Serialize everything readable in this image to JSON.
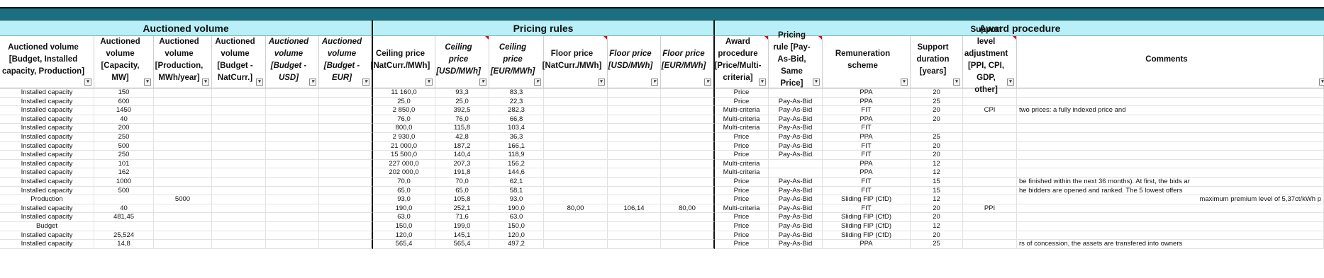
{
  "groups": {
    "auctioned_volume": "Auctioned volume",
    "pricing_rules": "Pricing rules",
    "award_procedure": "Award procedure"
  },
  "headers": [
    "Auctioned volume [Budget, Installed capacity, Production]",
    "Auctioned volume [Capacity, MW]",
    "Auctioned volume [Production, MWh/year]",
    "Auctioned volume [Budget - NatCurr.]",
    "Auctioned volume [Budget - USD]",
    "Auctioned volume [Budget - EUR]",
    "Ceiling price [NatCurr./MWh]",
    "Ceiling price [USD/MWh]",
    "Ceiling price [EUR/MWh]",
    "Floor price [NatCurr./MWh]",
    "Floor price [USD/MWh]",
    "Floor price [EUR/MWh]",
    "Award procedure [Price/Multi-criteria]",
    "Pricing rule [Pay-As-Bid, Same Price]",
    "Remuneration scheme",
    "Support duration [years]",
    "Support level adjustment [PPI, CPI, GDP, other]",
    "Comments"
  ],
  "rows": [
    [
      "Installed capacity",
      "150",
      "",
      "",
      "",
      "",
      "11 160,0",
      "93,3",
      "83,3",
      "",
      "",
      "",
      "Price",
      "",
      "PPA",
      "20",
      "",
      ""
    ],
    [
      "Installed capacity",
      "600",
      "",
      "",
      "",
      "",
      "25,0",
      "25,0",
      "22,3",
      "",
      "",
      "",
      "Price",
      "Pay-As-Bid",
      "PPA",
      "25",
      "",
      ""
    ],
    [
      "Installed capacity",
      "1450",
      "",
      "",
      "",
      "",
      "2 850,0",
      "392,5",
      "282,3",
      "",
      "",
      "",
      "Multi-criteria",
      "Pay-As-Bid",
      "FIT",
      "20",
      "CPI",
      "two prices: a fully indexed price and"
    ],
    [
      "Installed capacity",
      "40",
      "",
      "",
      "",
      "",
      "76,0",
      "76,0",
      "66,8",
      "",
      "",
      "",
      "Multi-criteria",
      "Pay-As-Bid",
      "PPA",
      "20",
      "",
      ""
    ],
    [
      "Installed capacity",
      "200",
      "",
      "",
      "",
      "",
      "800,0",
      "115,8",
      "103,4",
      "",
      "",
      "",
      "Multi-criteria",
      "Pay-As-Bid",
      "FIT",
      "",
      "",
      ""
    ],
    [
      "Installed capacity",
      "250",
      "",
      "",
      "",
      "",
      "2 930,0",
      "42,8",
      "36,3",
      "",
      "",
      "",
      "Price",
      "Pay-As-Bid",
      "PPA",
      "25",
      "",
      ""
    ],
    [
      "Installed capacity",
      "500",
      "",
      "",
      "",
      "",
      "21 000,0",
      "187,2",
      "166,1",
      "",
      "",
      "",
      "Price",
      "Pay-As-Bid",
      "FIT",
      "20",
      "",
      ""
    ],
    [
      "Installed capacity",
      "250",
      "",
      "",
      "",
      "",
      "15 500,0",
      "140,4",
      "118,9",
      "",
      "",
      "",
      "Price",
      "Pay-As-Bid",
      "FIT",
      "20",
      "",
      ""
    ],
    [
      "Installed capacity",
      "101",
      "",
      "",
      "",
      "",
      "227 000,0",
      "207,3",
      "156,2",
      "",
      "",
      "",
      "Multi-criteria",
      "",
      "PPA",
      "12",
      "",
      ""
    ],
    [
      "Installed capacity",
      "162",
      "",
      "",
      "",
      "",
      "202 000,0",
      "191,8",
      "144,6",
      "",
      "",
      "",
      "Multi-criteria",
      "",
      "PPA",
      "12",
      "",
      ""
    ],
    [
      "Installed capacity",
      "1000",
      "",
      "",
      "",
      "",
      "70,0",
      "70,0",
      "62,1",
      "",
      "",
      "",
      "Price",
      "Pay-As-Bid",
      "FIT",
      "15",
      "",
      "be finished within the next 36 months). At first, the bids ar"
    ],
    [
      "Installed capacity",
      "500",
      "",
      "",
      "",
      "",
      "65,0",
      "65,0",
      "58,1",
      "",
      "",
      "",
      "Price",
      "Pay-As-Bid",
      "FIT",
      "15",
      "",
      "he bidders are opened and ranked. The 5 lowest offers"
    ],
    [
      "Production",
      "",
      "5000",
      "",
      "",
      "",
      "93,0",
      "105,8",
      "93,0",
      "",
      "",
      "",
      "Price",
      "Pay-As-Bid",
      "Sliding FIP (CfD)",
      "12",
      "",
      "maximum premium level of 5,37ct/kWh p"
    ],
    [
      "Installed capacity",
      "40",
      "",
      "",
      "",
      "",
      "190,0",
      "252,1",
      "190,0",
      "80,00",
      "106,14",
      "80,00",
      "Multi-criteria",
      "Pay-As-Bid",
      "FIT",
      "20",
      "PPI",
      ""
    ],
    [
      "Installed capacity",
      "481,45",
      "",
      "",
      "",
      "",
      "63,0",
      "71,6",
      "63,0",
      "",
      "",
      "",
      "Price",
      "Pay-As-Bid",
      "Sliding FIP (CfD)",
      "20",
      "",
      ""
    ],
    [
      "Budget",
      "",
      "",
      "",
      "",
      "",
      "150,0",
      "199,0",
      "150,0",
      "",
      "",
      "",
      "Price",
      "Pay-As-Bid",
      "Sliding FIP (CfD)",
      "12",
      "",
      ""
    ],
    [
      "Installed capacity",
      "25,524",
      "",
      "",
      "",
      "",
      "120,0",
      "145,1",
      "120,0",
      "",
      "",
      "",
      "Price",
      "Pay-As-Bid",
      "Sliding FIP (CfD)",
      "20",
      "",
      ""
    ],
    [
      "Installed capacity",
      "14,8",
      "",
      "",
      "",
      "",
      "565,4",
      "565,4",
      "497,2",
      "",
      "",
      "",
      "Price",
      "Pay-As-Bid",
      "PPA",
      "25",
      "",
      "rs of concession, the assets are transfered into owners"
    ]
  ]
}
